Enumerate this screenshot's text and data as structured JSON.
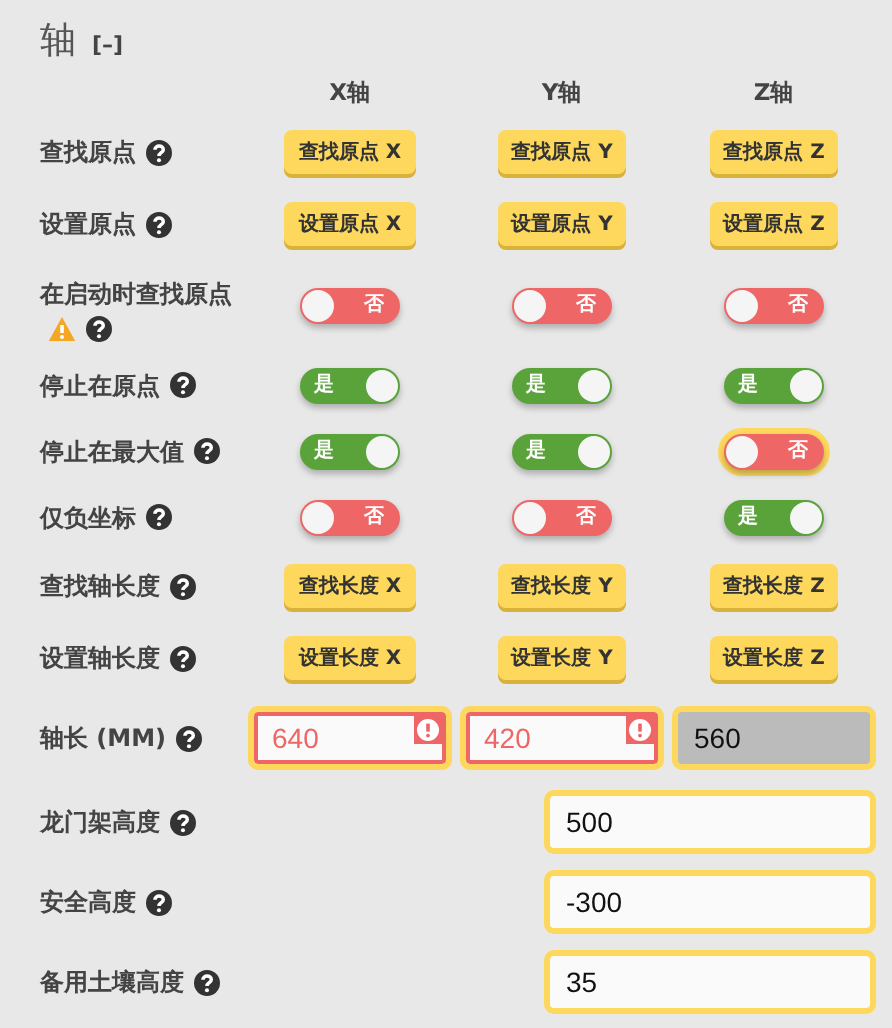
{
  "section": {
    "title": "轴",
    "collapse": "[–]"
  },
  "columns": [
    "X轴",
    "Y轴",
    "Z轴"
  ],
  "rows": [
    {
      "kind": "buttons",
      "label": "查找原点",
      "warning": false,
      "cells": [
        {
          "label": "查找原点 X"
        },
        {
          "label": "查找原点 Y"
        },
        {
          "label": "查找原点 Z"
        }
      ]
    },
    {
      "kind": "buttons",
      "label": "设置原点",
      "warning": false,
      "cells": [
        {
          "label": "设置原点 X"
        },
        {
          "label": "设置原点 Y"
        },
        {
          "label": "设置原点 Z"
        }
      ]
    },
    {
      "kind": "toggles",
      "label": "在启动时查找原点",
      "warning": true,
      "cells": [
        {
          "on": false,
          "label": "否",
          "highlighted": false
        },
        {
          "on": false,
          "label": "否",
          "highlighted": false
        },
        {
          "on": false,
          "label": "否",
          "highlighted": false
        }
      ]
    },
    {
      "kind": "toggles",
      "label": "停止在原点",
      "warning": false,
      "cells": [
        {
          "on": true,
          "label": "是",
          "highlighted": false
        },
        {
          "on": true,
          "label": "是",
          "highlighted": false
        },
        {
          "on": true,
          "label": "是",
          "highlighted": false
        }
      ]
    },
    {
      "kind": "toggles",
      "label": "停止在最大值",
      "warning": false,
      "cells": [
        {
          "on": true,
          "label": "是",
          "highlighted": false
        },
        {
          "on": true,
          "label": "是",
          "highlighted": false
        },
        {
          "on": false,
          "label": "否",
          "highlighted": true
        }
      ]
    },
    {
      "kind": "toggles",
      "label": "仅负坐标",
      "warning": false,
      "cells": [
        {
          "on": false,
          "label": "否",
          "highlighted": false
        },
        {
          "on": false,
          "label": "否",
          "highlighted": false
        },
        {
          "on": true,
          "label": "是",
          "highlighted": false
        }
      ]
    },
    {
      "kind": "buttons",
      "label": "查找轴长度",
      "warning": false,
      "cells": [
        {
          "label": "查找长度 X"
        },
        {
          "label": "查找长度 Y"
        },
        {
          "label": "查找长度 Z"
        }
      ]
    },
    {
      "kind": "buttons",
      "label": "设置轴长度",
      "warning": false,
      "cells": [
        {
          "label": "设置长度 X"
        },
        {
          "label": "设置长度 Y"
        },
        {
          "label": "设置长度 Z"
        }
      ]
    },
    {
      "kind": "inputs",
      "label": "轴长 (MM)",
      "warning": false,
      "cells": [
        {
          "value": "640",
          "error": true,
          "disabled": false
        },
        {
          "value": "420",
          "error": true,
          "disabled": false
        },
        {
          "value": "560",
          "error": false,
          "disabled": true
        }
      ]
    },
    {
      "kind": "single",
      "label": "龙门架高度",
      "warning": false,
      "cells": [
        {
          "value": "500",
          "error": false,
          "disabled": false
        }
      ]
    },
    {
      "kind": "single",
      "label": "安全高度",
      "warning": false,
      "cells": [
        {
          "value": "-300",
          "error": false,
          "disabled": false
        }
      ]
    },
    {
      "kind": "single",
      "label": "备用土壤高度",
      "warning": false,
      "cells": [
        {
          "value": "35",
          "error": false,
          "disabled": false
        }
      ]
    }
  ]
}
